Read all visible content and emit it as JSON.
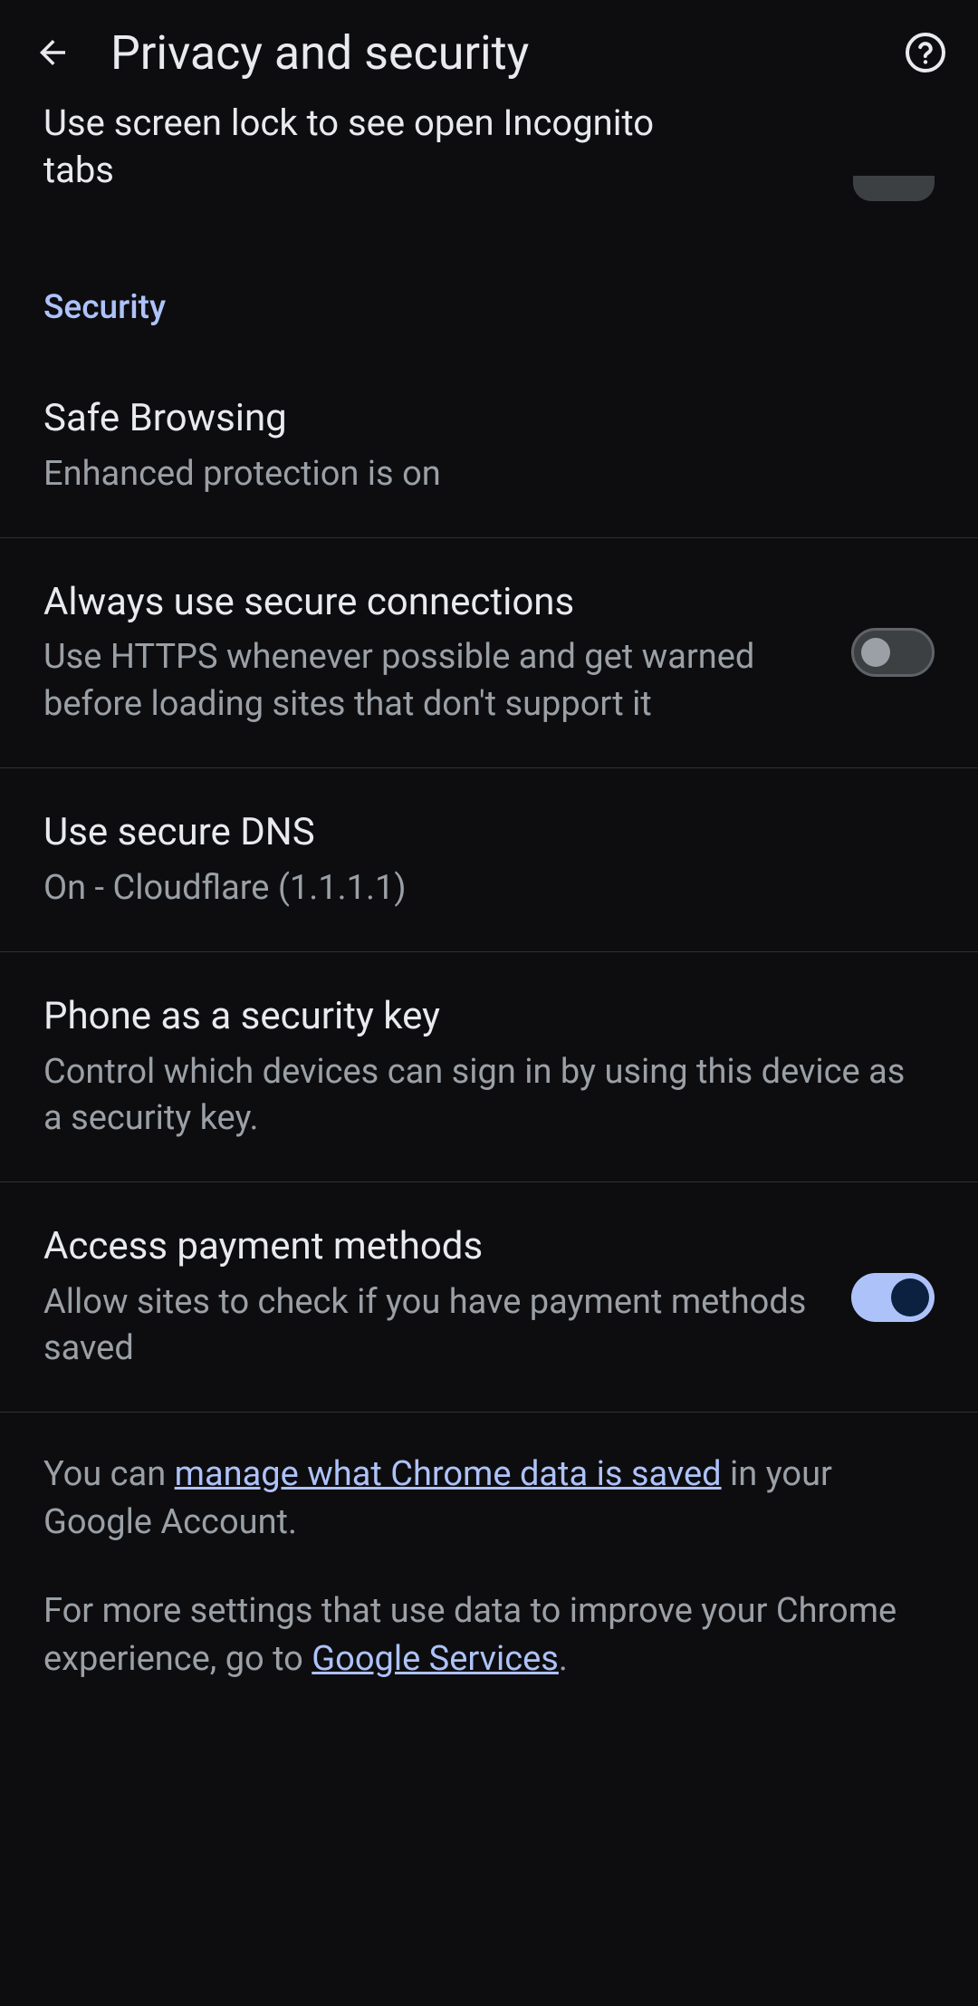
{
  "header": {
    "title": "Privacy and security"
  },
  "truncated_item": {
    "text": "Use screen lock to see open Incognito tabs"
  },
  "section": {
    "label": "Security"
  },
  "items": {
    "safe_browsing": {
      "title": "Safe Browsing",
      "subtitle": "Enhanced protection is on"
    },
    "secure_connections": {
      "title": "Always use secure connections",
      "subtitle": "Use HTTPS whenever possible and get warned before loading sites that don't support it",
      "toggle": false
    },
    "secure_dns": {
      "title": "Use secure DNS",
      "subtitle": "On - Cloudflare (1.1.1.1)"
    },
    "security_key": {
      "title": "Phone as a security key",
      "subtitle": "Control which devices can sign in by using this device as a security key."
    },
    "payment_methods": {
      "title": "Access payment methods",
      "subtitle": "Allow sites to check if you have payment methods saved",
      "toggle": true
    }
  },
  "footer": {
    "para1_prefix": "You can ",
    "para1_link": "manage what Chrome data is saved",
    "para1_suffix": " in your Google Account.",
    "para2_prefix": "For more settings that use data to improve your Chrome experience, go to ",
    "para2_link": "Google Services",
    "para2_suffix": "."
  }
}
